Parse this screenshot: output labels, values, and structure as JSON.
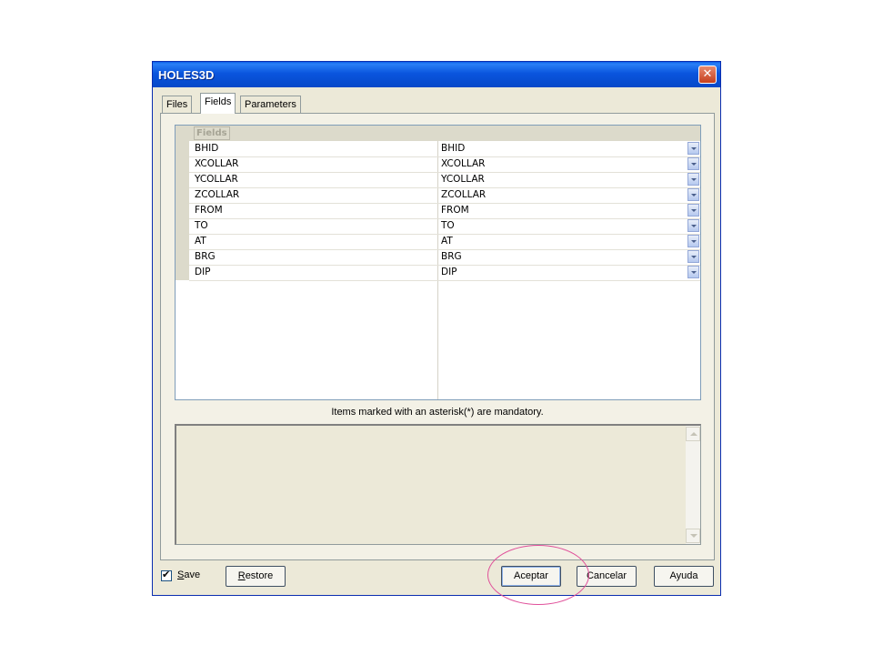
{
  "window": {
    "title": "HOLES3D",
    "close_glyph": "✕"
  },
  "tabs": [
    {
      "label": "Files"
    },
    {
      "label": "Fields",
      "active": true
    },
    {
      "label": "Parameters"
    }
  ],
  "grid": {
    "group_label": "Fields",
    "rows": [
      {
        "name": "BHID",
        "value": "BHID"
      },
      {
        "name": "XCOLLAR",
        "value": "XCOLLAR"
      },
      {
        "name": "YCOLLAR",
        "value": "YCOLLAR"
      },
      {
        "name": "ZCOLLAR",
        "value": "ZCOLLAR"
      },
      {
        "name": "FROM",
        "value": "FROM"
      },
      {
        "name": "TO",
        "value": "TO"
      },
      {
        "name": "AT",
        "value": "AT"
      },
      {
        "name": "BRG",
        "value": "BRG"
      },
      {
        "name": "DIP",
        "value": "DIP"
      }
    ]
  },
  "mandatory_note": "Items marked with an asterisk(*) are mandatory.",
  "footer": {
    "save_label": "Save",
    "save_checked": true,
    "restore_label": "Restore",
    "accept_label": "Aceptar",
    "cancel_label": "Cancelar",
    "help_label": "Ayuda"
  },
  "icons": {
    "check_glyph": "✔"
  },
  "colors": {
    "titlebar": "#0a55de",
    "window_bg": "#ece9d8",
    "annotation": "#e0509a"
  }
}
